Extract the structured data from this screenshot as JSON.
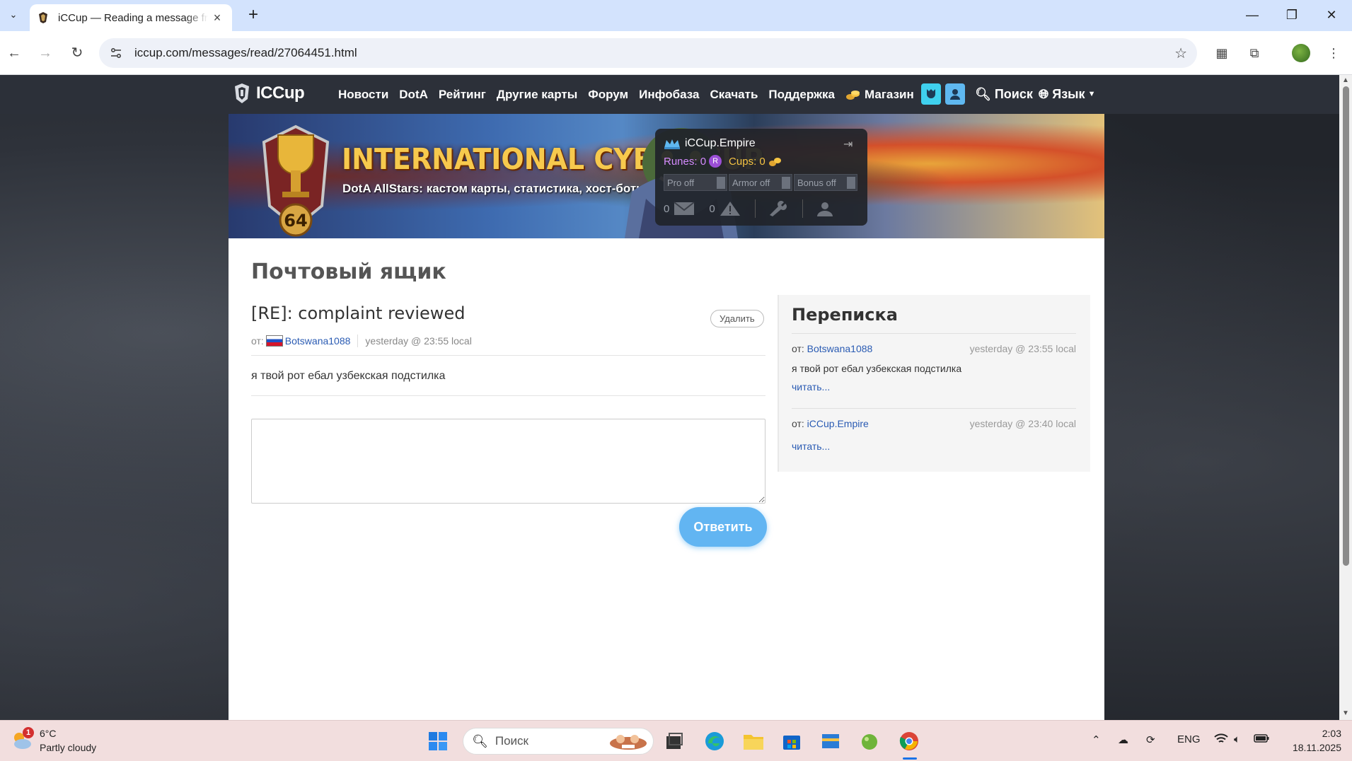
{
  "browser": {
    "tab_title": "iCCup — Reading a message from",
    "url": "iccup.com/messages/read/27064451.html"
  },
  "site": {
    "logo_text": "ICCup",
    "nav": [
      "Новости",
      "DotA",
      "Рейтинг",
      "Другие карты",
      "Форум",
      "Инфобаза",
      "Скачать",
      "Поддержка"
    ],
    "shop_label": "Магазин",
    "search_label": "Поиск",
    "lang_label": "Язык"
  },
  "banner": {
    "title": "INTERNATIONAL CYBER CUP",
    "subtitle": "DotA AllStars: кастом карты, статистика, хост-боты",
    "badge_number": "64"
  },
  "user_panel": {
    "username": "iCCup.Empire",
    "runes_label": "Runes: 0",
    "rune_badge": "R",
    "cups_label": "Cups: 0",
    "toggles": [
      "Pro off",
      "Armor off",
      "Bonus off"
    ],
    "mail_count": "0",
    "warn_count": "0"
  },
  "mailbox": {
    "page_title": "Почтовый ящик",
    "subject": "[RE]: complaint reviewed",
    "delete_label": "Удалить",
    "from_label": "от:",
    "author": "Botswana1088",
    "time": "yesterday @ 23:55 local",
    "body": "я твой рот ебал узбекская подстилка",
    "reply_text": "",
    "reply_label": "Ответить"
  },
  "conversation": {
    "title": "Переписка",
    "items": [
      {
        "from_label": "от:",
        "author": "Botswana1088",
        "time": "yesterday @ 23:55 local",
        "text": "я твой рот ебал узбекская подстилка",
        "read_label": "читать..."
      },
      {
        "from_label": "от:",
        "author": "iCCup.Empire",
        "time": "yesterday @ 23:40 local",
        "text": "",
        "read_label": "читать..."
      }
    ]
  },
  "taskbar": {
    "temperature": "6°C",
    "weather_text": "Partly cloudy",
    "weather_badge": "1",
    "search_placeholder": "Поиск",
    "lang": "ENG",
    "time": "2:03",
    "date": "18.11.2025"
  },
  "colors": {
    "accent": "#62b5f2",
    "link": "#2a5bb3",
    "nav_bg": "#2c3039",
    "banner_title": "#f7c94d"
  }
}
